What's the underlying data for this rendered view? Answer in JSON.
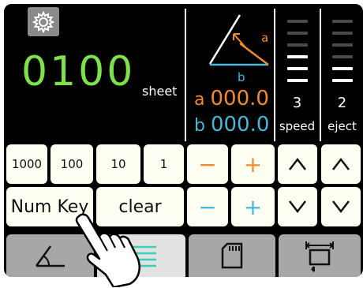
{
  "settings": {
    "icon": "gear-icon"
  },
  "counter": {
    "value": "0100",
    "unit": "sheet"
  },
  "angles": {
    "diagram_icon": "triangle-angle-icon",
    "a_symbol": "a",
    "b_symbol": "b",
    "a_label": "a",
    "a_value": "000.0",
    "b_label": "b",
    "b_value": "000.0"
  },
  "speed": {
    "value": "3",
    "label": "speed",
    "level": 3,
    "max": 6
  },
  "eject": {
    "value": "2",
    "label": "eject",
    "level": 2,
    "max": 6
  },
  "keypad": {
    "increments": [
      "1000",
      "100",
      "10",
      "1"
    ],
    "numkey_label": "Num Key",
    "clear_label": "clear",
    "a_minus": "−",
    "a_plus": "+",
    "b_minus": "−",
    "b_plus": "+"
  },
  "tabs": [
    {
      "icon": "angle-icon",
      "active": false
    },
    {
      "icon": "list-icon",
      "active": true
    },
    {
      "icon": "card-icon",
      "active": false
    },
    {
      "icon": "stack-size-icon",
      "active": false
    }
  ],
  "colors": {
    "green": "#7ee04a",
    "orange": "#f28a2e",
    "cyan": "#4ab5d6",
    "panel": "#000000",
    "key": "#fffef2",
    "tab": "#a7a7a7",
    "tab_active": "#e2e2e2"
  }
}
